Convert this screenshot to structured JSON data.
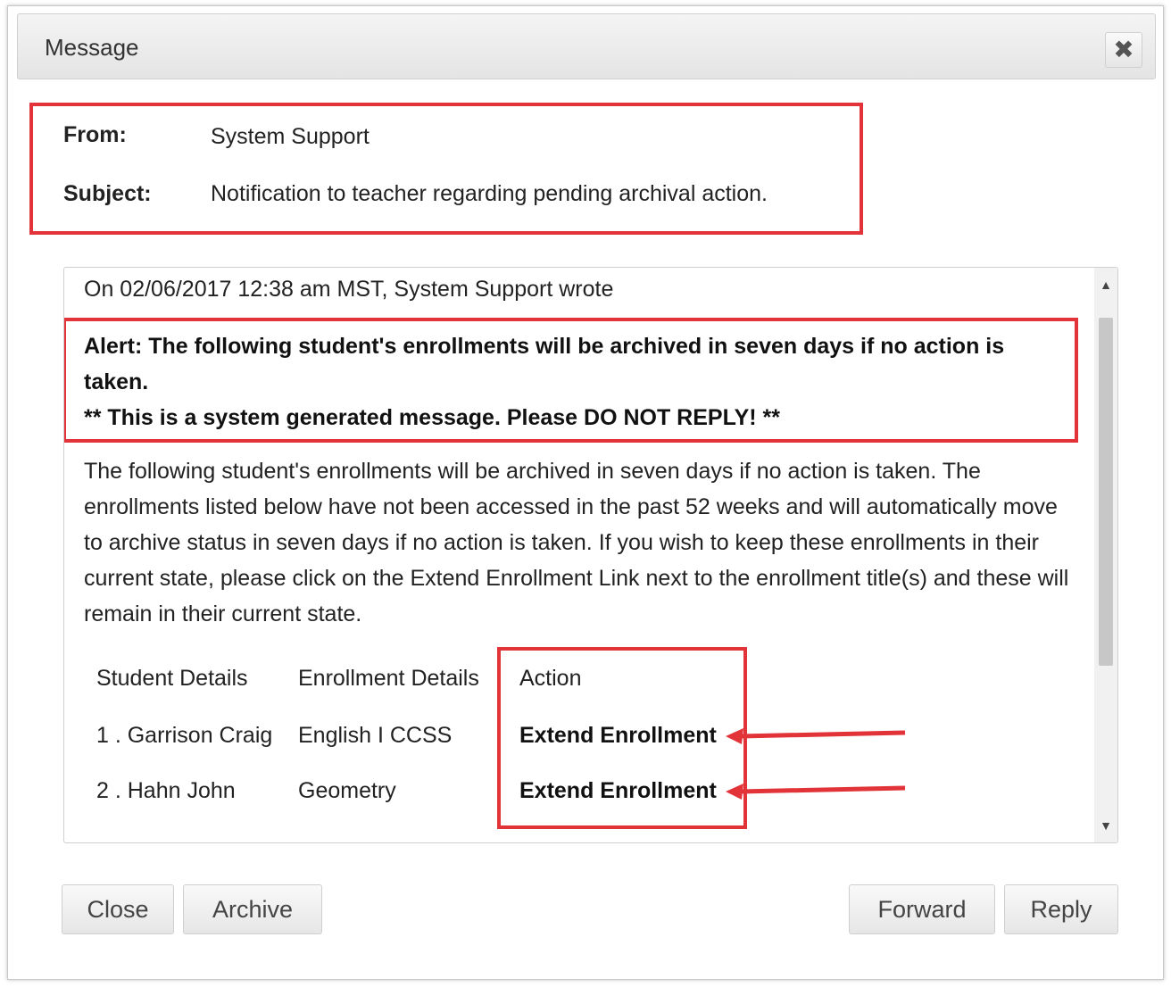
{
  "dialog": {
    "title": "Message",
    "close_icon": "close-icon"
  },
  "header": {
    "from_label": "From:",
    "from_value": "System Support",
    "subject_label": "Subject:",
    "subject_value": "Notification to teacher regarding pending archival action."
  },
  "message": {
    "wrote_line": "On 02/06/2017 12:38 am MST, System Support wrote",
    "alert_line1": "Alert: The following student's enrollments will be archived in seven days if no action is taken.",
    "alert_line2": "** This is a system generated message. Please DO NOT REPLY! **",
    "body": "The following student's enrollments will be archived in seven days if no action is taken. The enrollments listed below have not been accessed in the past 52 weeks and will automatically move to archive status in seven days if no action is taken. If you wish to keep these enrollments in their current state, please click on the Extend Enrollment Link next to the enrollment title(s) and these will remain in their current state.",
    "table": {
      "headers": [
        "Student Details",
        "Enrollment Details",
        "Action"
      ],
      "rows": [
        {
          "student": "1 . Garrison Craig",
          "enrollment": "English I CCSS",
          "action": "Extend Enrollment"
        },
        {
          "student": "2 . Hahn John",
          "enrollment": "Geometry",
          "action": "Extend Enrollment"
        }
      ]
    }
  },
  "buttons": {
    "close": "Close",
    "archive": "Archive",
    "forward": "Forward",
    "reply": "Reply"
  },
  "colors": {
    "highlight": "#e23338"
  }
}
